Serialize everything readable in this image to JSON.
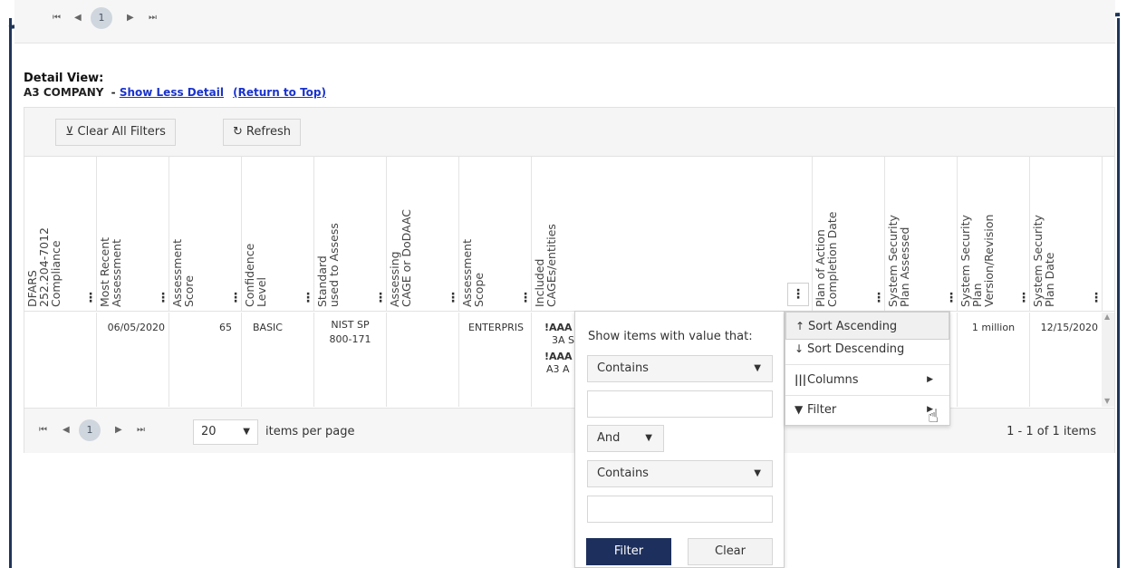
{
  "top_pager": {
    "current_page": "1"
  },
  "detail": {
    "heading": "Detail View:",
    "company": "A3 COMPANY",
    "separator": "-",
    "show_less": "Show Less Detail",
    "return_top": "(Return to Top)"
  },
  "toolbar": {
    "clear_filters_label": "Clear All Filters",
    "refresh_label": "Refresh"
  },
  "columns": [
    {
      "label": "DFARS\n252.204-7012\nCompliance",
      "dots": "⋮"
    },
    {
      "label": "Most Recent\nAssessment",
      "dots": "⋮"
    },
    {
      "label": "Assessment\nScore",
      "dots": "⋮"
    },
    {
      "label": "Confidence\nLevel",
      "dots": "⋮"
    },
    {
      "label": "Standard\nused to Assess",
      "dots": "⋮"
    },
    {
      "label": "Assessing\nCAGE or DoDAAC",
      "dots": "⋮"
    },
    {
      "label": "Assessment\nScope",
      "dots": "⋮"
    },
    {
      "label": "Included\nCAGEs/entities",
      "dots": "⋮"
    },
    {
      "label": "Plan of Action\nCompletion Date",
      "dots": "⋮"
    },
    {
      "label": "System Security\nPlan Assessed",
      "dots": "⋮"
    },
    {
      "label": "System Security\nPlan\nVersion/Revision",
      "dots": "⋮"
    },
    {
      "label": "System Security\nPlan Date",
      "dots": "⋮"
    }
  ],
  "row": {
    "most_recent": "06/05/2020",
    "score": "65",
    "confidence": "BASIC",
    "standard_line1": "NIST SP",
    "standard_line2": "800-171",
    "scope": "ENTERPRIS",
    "cage1_line1": "!AAA",
    "cage1_line2": "3A S",
    "cage2_line1": "!AAA",
    "cage2_line2": "A3 A",
    "ssp_version": "1 million",
    "ssp_date": "12/15/2020"
  },
  "pager": {
    "current_page": "1",
    "page_size": "20",
    "items_per_page_label": "items per page",
    "count_label": "1 - 1 of 1 items"
  },
  "column_menu": {
    "sort_asc": "Sort Ascending",
    "sort_desc": "Sort Descending",
    "columns": "Columns",
    "filter": "Filter"
  },
  "filter_popup": {
    "heading": "Show items with value that:",
    "operator1": "Contains",
    "value1": "",
    "logic": "And",
    "operator2": "Contains",
    "value2": "",
    "filter_button": "Filter",
    "clear_button": "Clear"
  },
  "colors": {
    "frame": "#1f3559",
    "primary_button": "#1d2f5c",
    "link": "#1a33cc"
  }
}
